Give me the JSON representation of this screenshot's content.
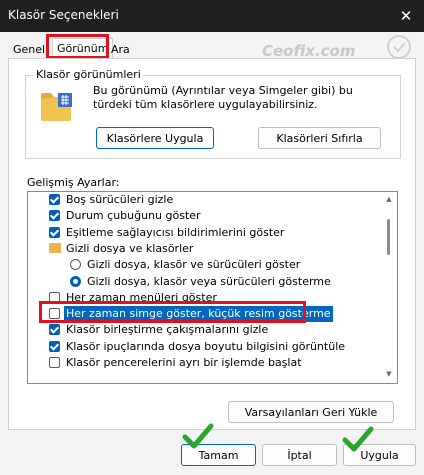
{
  "window": {
    "title": "Klasör Seçenekleri",
    "close_glyph": "✕"
  },
  "watermark": "Ceofix.com",
  "tabs": [
    {
      "label": "Genel"
    },
    {
      "label": "Görünüm"
    },
    {
      "label": "Ara"
    }
  ],
  "folder_views": {
    "group_label": "Klasör görünümleri",
    "description": "Bu görünümü (Ayrıntılar veya Simgeler gibi) bu türdeki tüm klasörlere uygulayabilirsiniz.",
    "apply_button": "Klasörlere Uygula",
    "reset_button": "Klasörleri Sıfırla"
  },
  "advanced": {
    "label": "Gelişmiş Ayarlar:",
    "items": [
      {
        "type": "checkbox",
        "checked": true,
        "label": "Boş sürücüleri gizle"
      },
      {
        "type": "checkbox",
        "checked": true,
        "label": "Durum çubuğunu göster"
      },
      {
        "type": "checkbox",
        "checked": true,
        "label": "Eşitleme sağlayıcısı bildirimlerini göster"
      },
      {
        "type": "folder",
        "label": "Gizli dosya ve klasörler"
      },
      {
        "type": "radio",
        "checked": false,
        "label": "Gizli dosya, klasör ve sürücüleri göster"
      },
      {
        "type": "radio",
        "checked": true,
        "label": "Gizli dosya, klasör veya sürücüleri gösterme"
      },
      {
        "type": "checkbox",
        "checked": false,
        "label": "Her zaman menüleri göster"
      },
      {
        "type": "checkbox",
        "checked": false,
        "label": "Her zaman simge göster, küçük resim gösterme",
        "selected": true
      },
      {
        "type": "checkbox",
        "checked": true,
        "label": "Klasör birleştirme çakışmalarını gizle"
      },
      {
        "type": "checkbox",
        "checked": true,
        "label": "Klasör ipuçlarında dosya boyutu bilgisini görüntüle"
      },
      {
        "type": "checkbox",
        "checked": false,
        "label": "Klasör pencerelerini ayrı bir işlemde başlat"
      }
    ]
  },
  "restore_button": "Varsayılanları Geri Yükle",
  "footer": {
    "ok": "Tamam",
    "cancel": "İptal",
    "apply": "Uygula"
  },
  "colors": {
    "accent": "#005fb8",
    "highlight_box": "#e0101c",
    "check_annotation": "#2aa52a"
  }
}
